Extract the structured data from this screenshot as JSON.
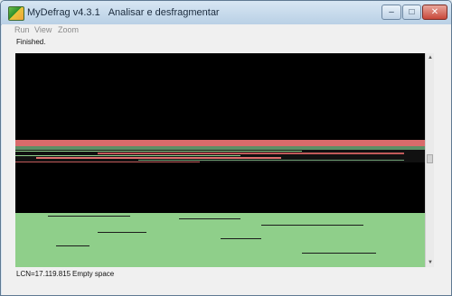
{
  "window": {
    "app_title": "MyDefrag v4.3.1",
    "job_title": "Analisar e desfragmentar",
    "minimize_glyph": "–",
    "maximize_glyph": "□",
    "close_glyph": "✕"
  },
  "menu": {
    "items": [
      {
        "label": "Run"
      },
      {
        "label": "View"
      },
      {
        "label": "Zoom"
      }
    ]
  },
  "status": {
    "message": "Finished."
  },
  "diskmap": {
    "colors": {
      "free": "#000000",
      "unmovable": "#e07070",
      "fragmented": "#c25a5a",
      "contiguous": "#8fcf8a",
      "mixed": "#6f9e74"
    }
  },
  "footer": {
    "lcn": "LCN=17.119.815",
    "cluster_type": "Empty space"
  },
  "scrollbar": {
    "up_glyph": "▲",
    "down_glyph": "▼"
  }
}
